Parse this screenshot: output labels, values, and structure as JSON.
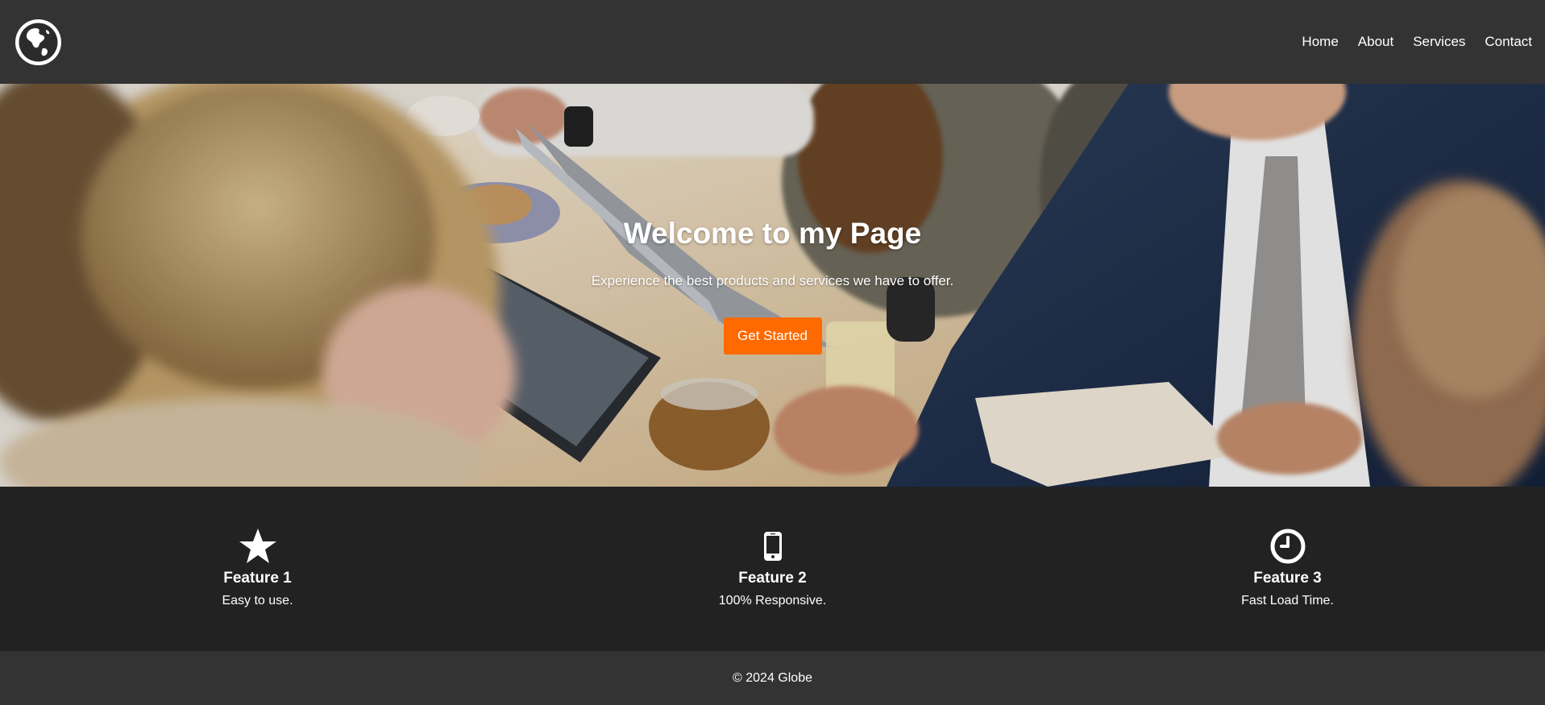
{
  "navbar": {
    "logo_icon": "globe-icon",
    "links": [
      "Home",
      "About",
      "Services",
      "Contact"
    ]
  },
  "hero": {
    "title": "Welcome to my Page",
    "subtitle": "Experience the best products and services we have to offer.",
    "button_label": "Get Started",
    "button_color": "#ff6a00"
  },
  "features": [
    {
      "icon": "star-icon",
      "title": "Feature 1",
      "description": "Easy to use."
    },
    {
      "icon": "mobile-phone-icon",
      "title": "Feature 2",
      "description": "100% Responsive."
    },
    {
      "icon": "clock-icon",
      "title": "Feature 3",
      "description": "Fast Load Time."
    }
  ],
  "footer": {
    "copyright": "© 2024 Globe"
  },
  "colors": {
    "navbar_bg": "#333333",
    "features_bg": "#222222",
    "accent": "#ff6a00"
  }
}
